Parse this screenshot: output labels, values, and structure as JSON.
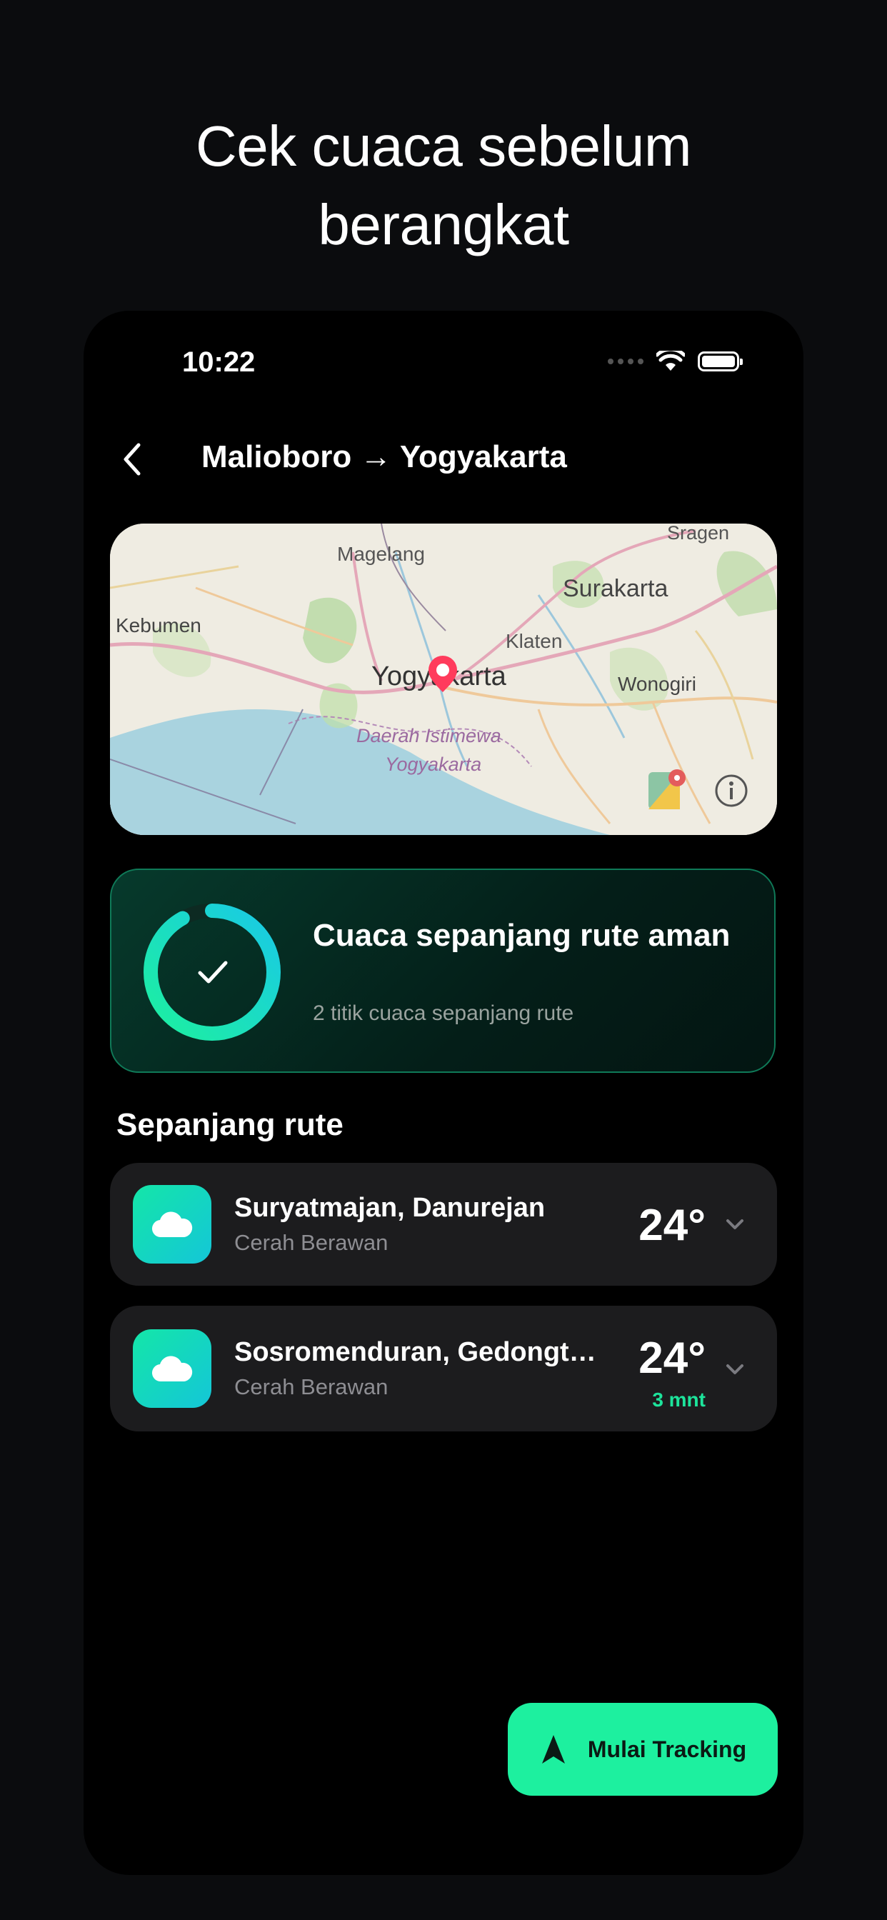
{
  "headline": {
    "line1": "Cek cuaca sebelum",
    "line2": "berangkat"
  },
  "status_bar": {
    "time": "10:22"
  },
  "nav": {
    "title": "Malioboro → Yogyakarta"
  },
  "map": {
    "labels": {
      "sragen": "Sragen",
      "magelang": "Magelang",
      "surakarta": "Surakarta",
      "kebumen": "Kebumen",
      "klaten": "Klaten",
      "yogyakarta": "Yogyakarta",
      "wonogiri": "Wonogiri",
      "diy1": "Daerah Istimewa",
      "diy2": "Yogyakarta"
    }
  },
  "summary": {
    "title": "Cuaca sepanjang rute aman",
    "subtitle": "2 titik cuaca sepanjang rute",
    "progress": 0.92
  },
  "section": {
    "title": "Sepanjang rute"
  },
  "route_items": [
    {
      "name": "Suryatmajan, Danurejan",
      "desc": "Cerah Berawan",
      "temp": "24°",
      "eta": ""
    },
    {
      "name": "Sosromenduran, Gedongt…",
      "desc": "Cerah Berawan",
      "temp": "24°",
      "eta": "3 mnt"
    }
  ],
  "cta": {
    "label": "Mulai Tracking"
  },
  "colors": {
    "accent": "#1df09f",
    "card_border": "#0f7a58",
    "pin": "#ff3b5c"
  }
}
